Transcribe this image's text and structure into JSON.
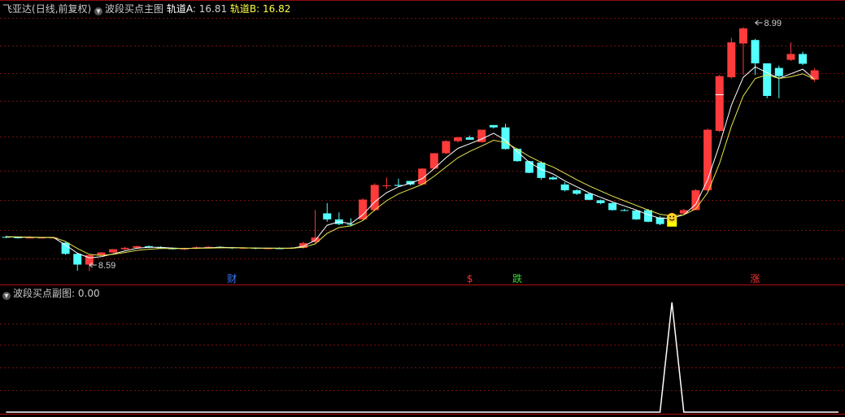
{
  "main_header": {
    "stock_name": "飞亚达",
    "period": "(日线,前复权)",
    "indicator_name": "波段买点主图",
    "line_a_label": "轨道A",
    "line_a_value": ": 16.81",
    "line_b_label": "轨道B",
    "line_b_value": ": 16.82"
  },
  "sub_header": {
    "indicator_name": "波段买点副图",
    "value": ": 0.00"
  },
  "colors": {
    "up": "#ff3b3b",
    "down": "#54ffff",
    "line_a": "#ffffff",
    "line_b": "#e8e84a",
    "grid": "#7a1010",
    "signal_box": "#ffff00",
    "event_cai": "#3a7bff",
    "event_dollar": "#ff3030",
    "event_die": "#33dd33",
    "event_zhang": "#ff3030",
    "sub_line": "#ffffff"
  },
  "chart_data": [
    {
      "type": "candlestick",
      "title": "波段买点主图",
      "ylim": [
        8.18,
        19.45
      ],
      "grid": "dotted horizontal",
      "x": [
        0,
        1,
        2,
        3,
        4,
        5,
        6,
        7,
        8,
        9,
        10,
        11,
        12,
        13,
        14,
        15,
        16,
        17,
        18,
        19,
        20,
        21,
        22,
        23,
        24,
        25,
        26,
        27,
        28,
        29,
        30,
        31,
        32,
        33,
        34,
        35,
        36,
        37,
        38,
        39,
        40,
        41,
        42,
        43,
        44,
        45,
        46,
        47,
        48,
        49,
        50,
        51,
        52,
        53,
        54,
        55,
        56,
        57,
        58,
        59,
        60,
        61,
        62,
        63,
        64,
        65,
        66,
        67,
        68,
        69,
        70
      ],
      "open": [
        10.05,
        10.03,
        10.02,
        10.02,
        10.02,
        9.8,
        9.32,
        8.86,
        9.27,
        9.38,
        9.52,
        9.58,
        9.65,
        9.6,
        9.58,
        9.52,
        9.55,
        9.6,
        9.62,
        9.6,
        9.56,
        9.58,
        9.55,
        9.56,
        9.55,
        9.58,
        9.83,
        11.06,
        10.8,
        10.6,
        10.8,
        11.2,
        12.26,
        12.28,
        12.45,
        12.3,
        12.98,
        13.64,
        14.16,
        14.32,
        14.12,
        14.85,
        14.75,
        13.83,
        13.3,
        13.24,
        12.6,
        12.3,
        12.05,
        11.9,
        11.62,
        11.5,
        11.2,
        11.18,
        11.2,
        10.88,
        10.72,
        11.05,
        11.2,
        12.05,
        14.6,
        16.9,
        18.35,
        18.5,
        17.5,
        17.3,
        17.65,
        17.9,
        16.8
      ],
      "close": [
        10.03,
        10.02,
        10.02,
        10.02,
        10.02,
        9.32,
        8.86,
        9.27,
        9.38,
        9.52,
        9.58,
        9.65,
        9.6,
        9.58,
        9.52,
        9.55,
        9.6,
        9.62,
        9.6,
        9.56,
        9.58,
        9.55,
        9.56,
        9.55,
        9.58,
        9.78,
        10.02,
        10.8,
        10.6,
        10.58,
        11.65,
        12.28,
        12.26,
        12.24,
        12.3,
        12.98,
        13.64,
        14.16,
        14.32,
        14.22,
        14.65,
        14.75,
        13.82,
        13.3,
        12.8,
        12.58,
        12.52,
        12.05,
        11.9,
        11.64,
        11.5,
        11.2,
        11.18,
        10.8,
        10.7,
        10.6,
        11.02,
        11.2,
        12.05,
        14.65,
        16.95,
        18.4,
        19.0,
        17.5,
        16.1,
        16.95,
        17.9,
        17.48,
        17.2
      ],
      "high": [
        10.1,
        10.05,
        10.08,
        10.05,
        10.05,
        9.82,
        9.35,
        9.28,
        9.4,
        9.53,
        9.62,
        9.67,
        9.68,
        9.64,
        9.6,
        9.58,
        9.64,
        9.66,
        9.64,
        9.62,
        9.6,
        9.6,
        9.59,
        9.6,
        9.62,
        9.85,
        11.2,
        11.5,
        11.1,
        10.85,
        11.7,
        12.35,
        12.6,
        12.55,
        12.45,
        13.0,
        13.65,
        14.2,
        14.35,
        14.4,
        14.58,
        14.85,
        14.9,
        13.85,
        13.32,
        13.3,
        12.65,
        12.4,
        12.1,
        11.92,
        11.65,
        11.55,
        11.25,
        11.22,
        11.25,
        10.95,
        11.08,
        11.25,
        12.1,
        14.7,
        17.0,
        18.6,
        19.05,
        18.55,
        17.5,
        17.4,
        18.4,
        18.0,
        17.3
      ],
      "low": [
        10.0,
        9.98,
        10.0,
        10.0,
        10.0,
        9.28,
        8.6,
        8.58,
        9.25,
        9.36,
        9.48,
        9.55,
        9.57,
        9.55,
        9.5,
        9.48,
        9.52,
        9.57,
        9.56,
        9.53,
        9.53,
        9.52,
        9.53,
        9.53,
        9.53,
        9.55,
        9.78,
        10.7,
        10.55,
        10.5,
        10.75,
        11.15,
        12.1,
        12.2,
        12.25,
        12.28,
        12.95,
        13.6,
        14.1,
        14.22,
        14.1,
        14.7,
        13.8,
        13.28,
        12.78,
        12.5,
        12.5,
        12.0,
        11.85,
        11.62,
        11.45,
        11.18,
        11.15,
        10.78,
        10.68,
        10.55,
        10.7,
        11.0,
        11.2,
        12.0,
        14.55,
        16.85,
        17.0,
        17.0,
        16.0,
        16.0,
        17.6,
        17.42,
        16.7
      ],
      "series": [
        {
          "name": "轨道A",
          "values": [
            10.05,
            10.04,
            10.03,
            10.02,
            10.02,
            9.7,
            9.35,
            9.15,
            9.2,
            9.32,
            9.45,
            9.56,
            9.6,
            9.6,
            9.57,
            9.55,
            9.57,
            9.58,
            9.6,
            9.59,
            9.58,
            9.57,
            9.56,
            9.56,
            9.56,
            9.65,
            9.9,
            10.55,
            10.7,
            10.62,
            11.0,
            11.55,
            11.95,
            12.2,
            12.35,
            12.55,
            12.98,
            13.45,
            13.85,
            14.05,
            14.25,
            14.5,
            14.2,
            13.7,
            13.25,
            12.95,
            12.75,
            12.45,
            12.2,
            11.95,
            11.75,
            11.55,
            11.38,
            11.2,
            11.0,
            10.85,
            10.85,
            11.0,
            11.45,
            12.5,
            14.0,
            15.7,
            16.9,
            17.35,
            17.1,
            16.85,
            17.05,
            17.25,
            16.81
          ]
        },
        {
          "name": "轨道B",
          "values": [
            10.06,
            10.05,
            10.04,
            10.03,
            10.03,
            9.85,
            9.55,
            9.3,
            9.25,
            9.3,
            9.38,
            9.47,
            9.52,
            9.55,
            9.55,
            9.55,
            9.56,
            9.57,
            9.58,
            9.58,
            9.58,
            9.57,
            9.57,
            9.56,
            9.56,
            9.6,
            9.75,
            10.2,
            10.45,
            10.52,
            10.75,
            11.2,
            11.6,
            11.9,
            12.1,
            12.3,
            12.65,
            13.05,
            13.45,
            13.72,
            13.95,
            14.2,
            14.1,
            13.82,
            13.5,
            13.25,
            13.05,
            12.78,
            12.5,
            12.25,
            12.02,
            11.8,
            11.6,
            11.4,
            11.2,
            11.02,
            10.95,
            11.0,
            11.25,
            11.95,
            13.2,
            14.8,
            16.1,
            16.85,
            17.0,
            16.85,
            16.92,
            17.05,
            16.82
          ]
        }
      ],
      "annotations": [
        {
          "text": "8.59",
          "x": 7,
          "y": 8.59
        },
        {
          "text": "8.99",
          "x": 63,
          "y": 19.0
        },
        {
          "text": "财",
          "x": 19
        },
        {
          "text": "$",
          "x": 39
        },
        {
          "text": "跌",
          "x": 43
        },
        {
          "text": "涨",
          "x": 63
        }
      ],
      "signal_markers": [
        {
          "kind": "box",
          "x": 56
        },
        {
          "kind": "smiley",
          "x": 56
        },
        {
          "kind": "dash",
          "x": 60
        }
      ]
    },
    {
      "type": "line",
      "title": "波段买点副图",
      "ylim": [
        0,
        1
      ],
      "grid": "dotted horizontal",
      "x": [
        0,
        1,
        2,
        3,
        4,
        5,
        6,
        7,
        8,
        9,
        10,
        11,
        12,
        13,
        14,
        15,
        16,
        17,
        18,
        19,
        20,
        21,
        22,
        23,
        24,
        25,
        26,
        27,
        28,
        29,
        30,
        31,
        32,
        33,
        34,
        35,
        36,
        37,
        38,
        39,
        40,
        41,
        42,
        43,
        44,
        45,
        46,
        47,
        48,
        49,
        50,
        51,
        52,
        53,
        54,
        55,
        56,
        57,
        58,
        59,
        60,
        61,
        62,
        63,
        64,
        65,
        66,
        67,
        68,
        69,
        70
      ],
      "series": [
        {
          "name": "波段买点副图",
          "values": [
            0,
            0,
            0,
            0,
            0,
            0,
            0,
            0,
            0,
            0,
            0,
            0,
            0,
            0,
            0,
            0,
            0,
            0,
            0,
            0,
            0,
            0,
            0,
            0,
            0,
            0,
            0,
            0,
            0,
            0,
            0,
            0,
            0,
            0,
            0,
            0,
            0,
            0,
            0,
            0,
            0,
            0,
            0,
            0,
            0,
            0,
            0,
            0,
            0,
            0,
            0,
            0,
            0,
            0,
            0,
            0,
            1,
            0,
            0,
            0,
            0,
            0,
            0,
            0,
            0,
            0,
            0,
            0,
            0,
            0,
            0
          ]
        }
      ]
    }
  ]
}
